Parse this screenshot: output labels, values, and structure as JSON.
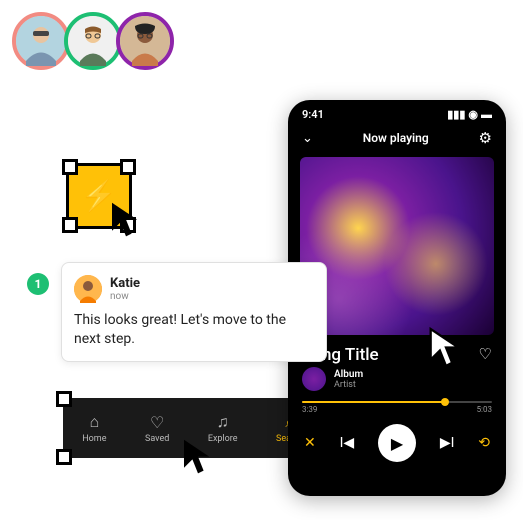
{
  "avatars": [
    "user-1",
    "user-2",
    "user-3"
  ],
  "step_badge": "1",
  "comment": {
    "author": "Katie",
    "time": "now",
    "body": "This looks great! Let's move to the next step."
  },
  "bottom_nav": {
    "items": [
      {
        "icon": "⌂",
        "label": "Home"
      },
      {
        "icon": "♡",
        "label": "Saved"
      },
      {
        "icon": "♫",
        "label": "Explore"
      },
      {
        "icon": "⌕",
        "label": "Search"
      }
    ]
  },
  "phone": {
    "time": "9:41",
    "header": "Now playing",
    "song_title": "Song Title",
    "album": "Album",
    "artist": "Artist",
    "elapsed": "3:39",
    "total": "5:03"
  }
}
